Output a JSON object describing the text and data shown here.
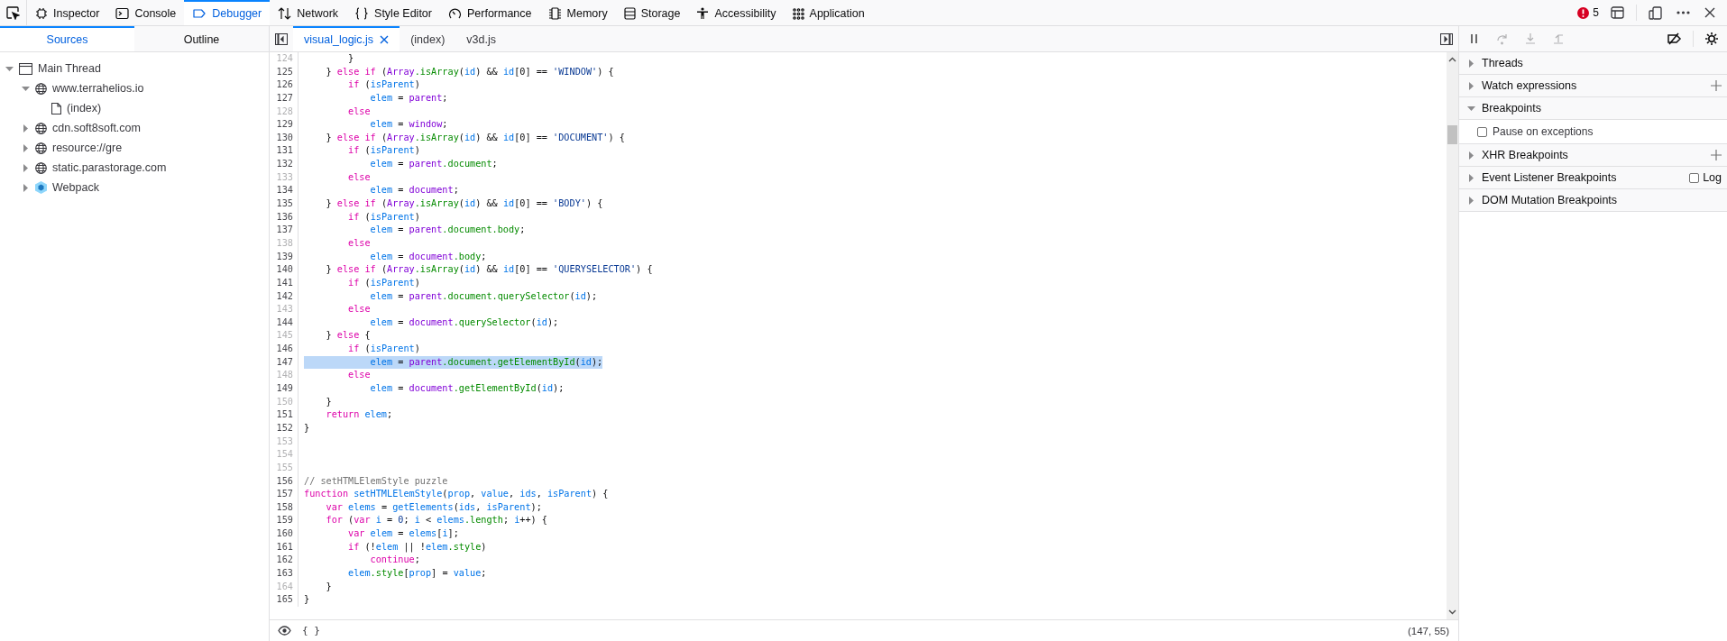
{
  "toolbar": {
    "tabs": [
      {
        "label": "Inspector",
        "selected": false
      },
      {
        "label": "Console",
        "selected": false
      },
      {
        "label": "Debugger",
        "selected": true
      },
      {
        "label": "Network",
        "selected": false
      },
      {
        "label": "Style Editor",
        "selected": false
      },
      {
        "label": "Performance",
        "selected": false
      },
      {
        "label": "Memory",
        "selected": false
      },
      {
        "label": "Storage",
        "selected": false
      },
      {
        "label": "Accessibility",
        "selected": false
      },
      {
        "label": "Application",
        "selected": false
      }
    ],
    "error_count": "5"
  },
  "sidebar": {
    "tabs": [
      {
        "label": "Sources",
        "selected": true
      },
      {
        "label": "Outline",
        "selected": false
      }
    ],
    "tree": [
      {
        "label": "Main Thread",
        "kind": "thread",
        "expanded": true,
        "children": [
          {
            "label": "www.terrahelios.io",
            "kind": "domain",
            "expanded": true,
            "children": [
              {
                "label": "(index)",
                "kind": "file"
              }
            ]
          },
          {
            "label": "cdn.soft8soft.com",
            "kind": "domain",
            "expanded": false
          },
          {
            "label": "resource://gre",
            "kind": "domain",
            "expanded": false
          },
          {
            "label": "static.parastorage.com",
            "kind": "domain",
            "expanded": false
          },
          {
            "label": "Webpack",
            "kind": "webpack",
            "expanded": false
          }
        ]
      }
    ]
  },
  "editor": {
    "tabs": [
      {
        "label": "visual_logic.js",
        "selected": true,
        "closable": true
      },
      {
        "label": "(index)",
        "selected": false,
        "closable": false
      },
      {
        "label": "v3d.js",
        "selected": false,
        "closable": false
      }
    ],
    "lines": [
      {
        "number": "124",
        "breakable": false,
        "highlighted": false,
        "tokens": [
          {
            "text": "        }",
            "kind": "punctuation"
          }
        ]
      },
      {
        "number": "125",
        "breakable": true,
        "highlighted": false,
        "tokens": [
          {
            "text": "    } ",
            "kind": "punctuation"
          },
          {
            "text": "else if",
            "kind": "keyword"
          },
          {
            "text": " (",
            "kind": "punctuation"
          },
          {
            "text": "Array",
            "kind": "global"
          },
          {
            "text": ".isArray",
            "kind": "property"
          },
          {
            "text": "(",
            "kind": "punctuation"
          },
          {
            "text": "id",
            "kind": "variable"
          },
          {
            "text": ") && ",
            "kind": "punctuation"
          },
          {
            "text": "id",
            "kind": "variable"
          },
          {
            "text": "[0] == ",
            "kind": "punctuation"
          },
          {
            "text": "'WINDOW'",
            "kind": "string"
          },
          {
            "text": ") {",
            "kind": "punctuation"
          }
        ]
      },
      {
        "number": "126",
        "breakable": true,
        "highlighted": false,
        "tokens": [
          {
            "text": "        if",
            "kind": "keyword"
          },
          {
            "text": " (",
            "kind": "punctuation"
          },
          {
            "text": "isParent",
            "kind": "variable"
          },
          {
            "text": ")",
            "kind": "punctuation"
          }
        ]
      },
      {
        "number": "127",
        "breakable": true,
        "highlighted": false,
        "tokens": [
          {
            "text": "            elem",
            "kind": "variable"
          },
          {
            "text": " = ",
            "kind": "punctuation"
          },
          {
            "text": "parent",
            "kind": "global"
          },
          {
            "text": ";",
            "kind": "punctuation"
          }
        ]
      },
      {
        "number": "128",
        "breakable": false,
        "highlighted": false,
        "tokens": [
          {
            "text": "        else",
            "kind": "keyword"
          }
        ]
      },
      {
        "number": "129",
        "breakable": true,
        "highlighted": false,
        "tokens": [
          {
            "text": "            elem",
            "kind": "variable"
          },
          {
            "text": " = ",
            "kind": "punctuation"
          },
          {
            "text": "window",
            "kind": "global"
          },
          {
            "text": ";",
            "kind": "punctuation"
          }
        ]
      },
      {
        "number": "130",
        "breakable": true,
        "highlighted": false,
        "tokens": [
          {
            "text": "    } ",
            "kind": "punctuation"
          },
          {
            "text": "else if",
            "kind": "keyword"
          },
          {
            "text": " (",
            "kind": "punctuation"
          },
          {
            "text": "Array",
            "kind": "global"
          },
          {
            "text": ".isArray",
            "kind": "property"
          },
          {
            "text": "(",
            "kind": "punctuation"
          },
          {
            "text": "id",
            "kind": "variable"
          },
          {
            "text": ") && ",
            "kind": "punctuation"
          },
          {
            "text": "id",
            "kind": "variable"
          },
          {
            "text": "[0] == ",
            "kind": "punctuation"
          },
          {
            "text": "'DOCUMENT'",
            "kind": "string"
          },
          {
            "text": ") {",
            "kind": "punctuation"
          }
        ]
      },
      {
        "number": "131",
        "breakable": true,
        "highlighted": false,
        "tokens": [
          {
            "text": "        if",
            "kind": "keyword"
          },
          {
            "text": " (",
            "kind": "punctuation"
          },
          {
            "text": "isParent",
            "kind": "variable"
          },
          {
            "text": ")",
            "kind": "punctuation"
          }
        ]
      },
      {
        "number": "132",
        "breakable": true,
        "highlighted": false,
        "tokens": [
          {
            "text": "            elem",
            "kind": "variable"
          },
          {
            "text": " = ",
            "kind": "punctuation"
          },
          {
            "text": "parent",
            "kind": "global"
          },
          {
            "text": ".document",
            "kind": "property"
          },
          {
            "text": ";",
            "kind": "punctuation"
          }
        ]
      },
      {
        "number": "133",
        "breakable": false,
        "highlighted": false,
        "tokens": [
          {
            "text": "        else",
            "kind": "keyword"
          }
        ]
      },
      {
        "number": "134",
        "breakable": true,
        "highlighted": false,
        "tokens": [
          {
            "text": "            elem",
            "kind": "variable"
          },
          {
            "text": " = ",
            "kind": "punctuation"
          },
          {
            "text": "document",
            "kind": "global"
          },
          {
            "text": ";",
            "kind": "punctuation"
          }
        ]
      },
      {
        "number": "135",
        "breakable": true,
        "highlighted": false,
        "tokens": [
          {
            "text": "    } ",
            "kind": "punctuation"
          },
          {
            "text": "else if",
            "kind": "keyword"
          },
          {
            "text": " (",
            "kind": "punctuation"
          },
          {
            "text": "Array",
            "kind": "global"
          },
          {
            "text": ".isArray",
            "kind": "property"
          },
          {
            "text": "(",
            "kind": "punctuation"
          },
          {
            "text": "id",
            "kind": "variable"
          },
          {
            "text": ") && ",
            "kind": "punctuation"
          },
          {
            "text": "id",
            "kind": "variable"
          },
          {
            "text": "[0] == ",
            "kind": "punctuation"
          },
          {
            "text": "'BODY'",
            "kind": "string"
          },
          {
            "text": ") {",
            "kind": "punctuation"
          }
        ]
      },
      {
        "number": "136",
        "breakable": true,
        "highlighted": false,
        "tokens": [
          {
            "text": "        if",
            "kind": "keyword"
          },
          {
            "text": " (",
            "kind": "punctuation"
          },
          {
            "text": "isParent",
            "kind": "variable"
          },
          {
            "text": ")",
            "kind": "punctuation"
          }
        ]
      },
      {
        "number": "137",
        "breakable": true,
        "highlighted": false,
        "tokens": [
          {
            "text": "            elem",
            "kind": "variable"
          },
          {
            "text": " = ",
            "kind": "punctuation"
          },
          {
            "text": "parent",
            "kind": "global"
          },
          {
            "text": ".document.body",
            "kind": "property"
          },
          {
            "text": ";",
            "kind": "punctuation"
          }
        ]
      },
      {
        "number": "138",
        "breakable": false,
        "highlighted": false,
        "tokens": [
          {
            "text": "        else",
            "kind": "keyword"
          }
        ]
      },
      {
        "number": "139",
        "breakable": true,
        "highlighted": false,
        "tokens": [
          {
            "text": "            elem",
            "kind": "variable"
          },
          {
            "text": " = ",
            "kind": "punctuation"
          },
          {
            "text": "document",
            "kind": "global"
          },
          {
            "text": ".body",
            "kind": "property"
          },
          {
            "text": ";",
            "kind": "punctuation"
          }
        ]
      },
      {
        "number": "140",
        "breakable": true,
        "highlighted": false,
        "tokens": [
          {
            "text": "    } ",
            "kind": "punctuation"
          },
          {
            "text": "else if",
            "kind": "keyword"
          },
          {
            "text": " (",
            "kind": "punctuation"
          },
          {
            "text": "Array",
            "kind": "global"
          },
          {
            "text": ".isArray",
            "kind": "property"
          },
          {
            "text": "(",
            "kind": "punctuation"
          },
          {
            "text": "id",
            "kind": "variable"
          },
          {
            "text": ") && ",
            "kind": "punctuation"
          },
          {
            "text": "id",
            "kind": "variable"
          },
          {
            "text": "[0] == ",
            "kind": "punctuation"
          },
          {
            "text": "'QUERYSELECTOR'",
            "kind": "string"
          },
          {
            "text": ") {",
            "kind": "punctuation"
          }
        ]
      },
      {
        "number": "141",
        "breakable": true,
        "highlighted": false,
        "tokens": [
          {
            "text": "        if",
            "kind": "keyword"
          },
          {
            "text": " (",
            "kind": "punctuation"
          },
          {
            "text": "isParent",
            "kind": "variable"
          },
          {
            "text": ")",
            "kind": "punctuation"
          }
        ]
      },
      {
        "number": "142",
        "breakable": true,
        "highlighted": false,
        "tokens": [
          {
            "text": "            elem",
            "kind": "variable"
          },
          {
            "text": " = ",
            "kind": "punctuation"
          },
          {
            "text": "parent",
            "kind": "global"
          },
          {
            "text": ".document.querySelector",
            "kind": "property"
          },
          {
            "text": "(",
            "kind": "punctuation"
          },
          {
            "text": "id",
            "kind": "variable"
          },
          {
            "text": ");",
            "kind": "punctuation"
          }
        ]
      },
      {
        "number": "143",
        "breakable": false,
        "highlighted": false,
        "tokens": [
          {
            "text": "        else",
            "kind": "keyword"
          }
        ]
      },
      {
        "number": "144",
        "breakable": true,
        "highlighted": false,
        "tokens": [
          {
            "text": "            elem",
            "kind": "variable"
          },
          {
            "text": " = ",
            "kind": "punctuation"
          },
          {
            "text": "document",
            "kind": "global"
          },
          {
            "text": ".querySelector",
            "kind": "property"
          },
          {
            "text": "(",
            "kind": "punctuation"
          },
          {
            "text": "id",
            "kind": "variable"
          },
          {
            "text": ");",
            "kind": "punctuation"
          }
        ]
      },
      {
        "number": "145",
        "breakable": false,
        "highlighted": false,
        "tokens": [
          {
            "text": "    } ",
            "kind": "punctuation"
          },
          {
            "text": "else",
            "kind": "keyword"
          },
          {
            "text": " {",
            "kind": "punctuation"
          }
        ]
      },
      {
        "number": "146",
        "breakable": true,
        "highlighted": false,
        "tokens": [
          {
            "text": "        if",
            "kind": "keyword"
          },
          {
            "text": " (",
            "kind": "punctuation"
          },
          {
            "text": "isParent",
            "kind": "variable"
          },
          {
            "text": ")",
            "kind": "punctuation"
          }
        ]
      },
      {
        "number": "147",
        "breakable": true,
        "highlighted": true,
        "tokens": [
          {
            "text": "            elem",
            "kind": "variable"
          },
          {
            "text": " = ",
            "kind": "punctuation"
          },
          {
            "text": "parent",
            "kind": "global"
          },
          {
            "text": ".document.getElementById",
            "kind": "property"
          },
          {
            "text": "(",
            "kind": "punctuation"
          },
          {
            "text": "id",
            "kind": "variable"
          },
          {
            "text": ");",
            "kind": "punctuation"
          }
        ]
      },
      {
        "number": "148",
        "breakable": false,
        "highlighted": false,
        "tokens": [
          {
            "text": "        else",
            "kind": "keyword"
          }
        ]
      },
      {
        "number": "149",
        "breakable": true,
        "highlighted": false,
        "tokens": [
          {
            "text": "            elem",
            "kind": "variable"
          },
          {
            "text": " = ",
            "kind": "punctuation"
          },
          {
            "text": "document",
            "kind": "global"
          },
          {
            "text": ".getElementById",
            "kind": "property"
          },
          {
            "text": "(",
            "kind": "punctuation"
          },
          {
            "text": "id",
            "kind": "variable"
          },
          {
            "text": ");",
            "kind": "punctuation"
          }
        ]
      },
      {
        "number": "150",
        "breakable": false,
        "highlighted": false,
        "tokens": [
          {
            "text": "    }",
            "kind": "punctuation"
          }
        ]
      },
      {
        "number": "151",
        "breakable": true,
        "highlighted": false,
        "tokens": [
          {
            "text": "    return ",
            "kind": "keyword"
          },
          {
            "text": "elem",
            "kind": "variable"
          },
          {
            "text": ";",
            "kind": "punctuation"
          }
        ]
      },
      {
        "number": "152",
        "breakable": true,
        "highlighted": false,
        "tokens": [
          {
            "text": "}",
            "kind": "punctuation"
          }
        ]
      },
      {
        "number": "153",
        "breakable": false,
        "highlighted": false
      },
      {
        "number": "154",
        "breakable": false,
        "highlighted": false
      },
      {
        "number": "155",
        "breakable": false,
        "highlighted": false
      },
      {
        "number": "156",
        "breakable": true,
        "highlighted": false,
        "tokens": [
          {
            "text": "// setHTMLElemStyle puzzle",
            "kind": "comment"
          }
        ]
      },
      {
        "number": "157",
        "breakable": true,
        "highlighted": false,
        "tokens": [
          {
            "text": "function ",
            "kind": "keyword"
          },
          {
            "text": "setHTMLElemStyle",
            "kind": "variable"
          },
          {
            "text": "(",
            "kind": "punctuation"
          },
          {
            "text": "prop",
            "kind": "variable"
          },
          {
            "text": ", ",
            "kind": "punctuation"
          },
          {
            "text": "value",
            "kind": "variable"
          },
          {
            "text": ", ",
            "kind": "punctuation"
          },
          {
            "text": "ids",
            "kind": "variable"
          },
          {
            "text": ", ",
            "kind": "punctuation"
          },
          {
            "text": "isParent",
            "kind": "variable"
          },
          {
            "text": ") {",
            "kind": "punctuation"
          }
        ]
      },
      {
        "number": "158",
        "breakable": true,
        "highlighted": false,
        "tokens": [
          {
            "text": "    var ",
            "kind": "keyword"
          },
          {
            "text": "elems",
            "kind": "variable"
          },
          {
            "text": " = ",
            "kind": "punctuation"
          },
          {
            "text": "getElements",
            "kind": "variable"
          },
          {
            "text": "(",
            "kind": "punctuation"
          },
          {
            "text": "ids",
            "kind": "variable"
          },
          {
            "text": ", ",
            "kind": "punctuation"
          },
          {
            "text": "isParent",
            "kind": "variable"
          },
          {
            "text": ");",
            "kind": "punctuation"
          }
        ]
      },
      {
        "number": "159",
        "breakable": true,
        "highlighted": false,
        "tokens": [
          {
            "text": "    for",
            "kind": "keyword"
          },
          {
            "text": " (",
            "kind": "punctuation"
          },
          {
            "text": "var ",
            "kind": "keyword"
          },
          {
            "text": "i",
            "kind": "variable"
          },
          {
            "text": " = ",
            "kind": "punctuation"
          },
          {
            "text": "0",
            "kind": "number"
          },
          {
            "text": "; ",
            "kind": "punctuation"
          },
          {
            "text": "i",
            "kind": "variable"
          },
          {
            "text": " < ",
            "kind": "punctuation"
          },
          {
            "text": "elems",
            "kind": "variable"
          },
          {
            "text": ".length",
            "kind": "property"
          },
          {
            "text": "; ",
            "kind": "punctuation"
          },
          {
            "text": "i",
            "kind": "variable"
          },
          {
            "text": "++) {",
            "kind": "punctuation"
          }
        ]
      },
      {
        "number": "160",
        "breakable": true,
        "highlighted": false,
        "tokens": [
          {
            "text": "        var ",
            "kind": "keyword"
          },
          {
            "text": "elem",
            "kind": "variable"
          },
          {
            "text": " = ",
            "kind": "punctuation"
          },
          {
            "text": "elems",
            "kind": "variable"
          },
          {
            "text": "[",
            "kind": "punctuation"
          },
          {
            "text": "i",
            "kind": "variable"
          },
          {
            "text": "];",
            "kind": "punctuation"
          }
        ]
      },
      {
        "number": "161",
        "breakable": true,
        "highlighted": false,
        "tokens": [
          {
            "text": "        if",
            "kind": "keyword"
          },
          {
            "text": " (!",
            "kind": "punctuation"
          },
          {
            "text": "elem",
            "kind": "variable"
          },
          {
            "text": " || !",
            "kind": "punctuation"
          },
          {
            "text": "elem",
            "kind": "variable"
          },
          {
            "text": ".style",
            "kind": "property"
          },
          {
            "text": ")",
            "kind": "punctuation"
          }
        ]
      },
      {
        "number": "162",
        "breakable": true,
        "highlighted": false,
        "tokens": [
          {
            "text": "            continue",
            "kind": "keyword"
          },
          {
            "text": ";",
            "kind": "punctuation"
          }
        ]
      },
      {
        "number": "163",
        "breakable": true,
        "highlighted": false,
        "tokens": [
          {
            "text": "        elem",
            "kind": "variable"
          },
          {
            "text": ".style",
            "kind": "property"
          },
          {
            "text": "[",
            "kind": "punctuation"
          },
          {
            "text": "prop",
            "kind": "variable"
          },
          {
            "text": "] = ",
            "kind": "punctuation"
          },
          {
            "text": "value",
            "kind": "variable"
          },
          {
            "text": ";",
            "kind": "punctuation"
          }
        ]
      },
      {
        "number": "164",
        "breakable": false,
        "highlighted": false,
        "tokens": [
          {
            "text": "    }",
            "kind": "punctuation"
          }
        ]
      },
      {
        "number": "165",
        "breakable": true,
        "highlighted": false,
        "tokens": [
          {
            "text": "}",
            "kind": "punctuation"
          }
        ]
      }
    ],
    "footer": {
      "pretty_print": "{ }",
      "cursor": "(147, 55)"
    }
  },
  "debug_panel": {
    "controls": [
      {
        "disabled": false
      },
      {
        "disabled": true
      },
      {
        "disabled": true
      },
      {
        "disabled": true
      }
    ],
    "sections": [
      {
        "label": "Threads",
        "expanded": false,
        "add_button": false
      },
      {
        "label": "Watch expressions",
        "expanded": false,
        "add_button": true
      },
      {
        "label": "Breakpoints",
        "expanded": true,
        "add_button": false,
        "options": [
          {
            "label": "Pause on exceptions",
            "checked": false
          }
        ]
      },
      {
        "label": "XHR Breakpoints",
        "expanded": false,
        "add_button": true
      },
      {
        "label": "Event Listener Breakpoints",
        "expanded": false,
        "add_button": false,
        "log": {
          "label": "Log",
          "checked": false
        }
      },
      {
        "label": "DOM Mutation Breakpoints",
        "expanded": false,
        "add_button": false
      }
    ]
  }
}
